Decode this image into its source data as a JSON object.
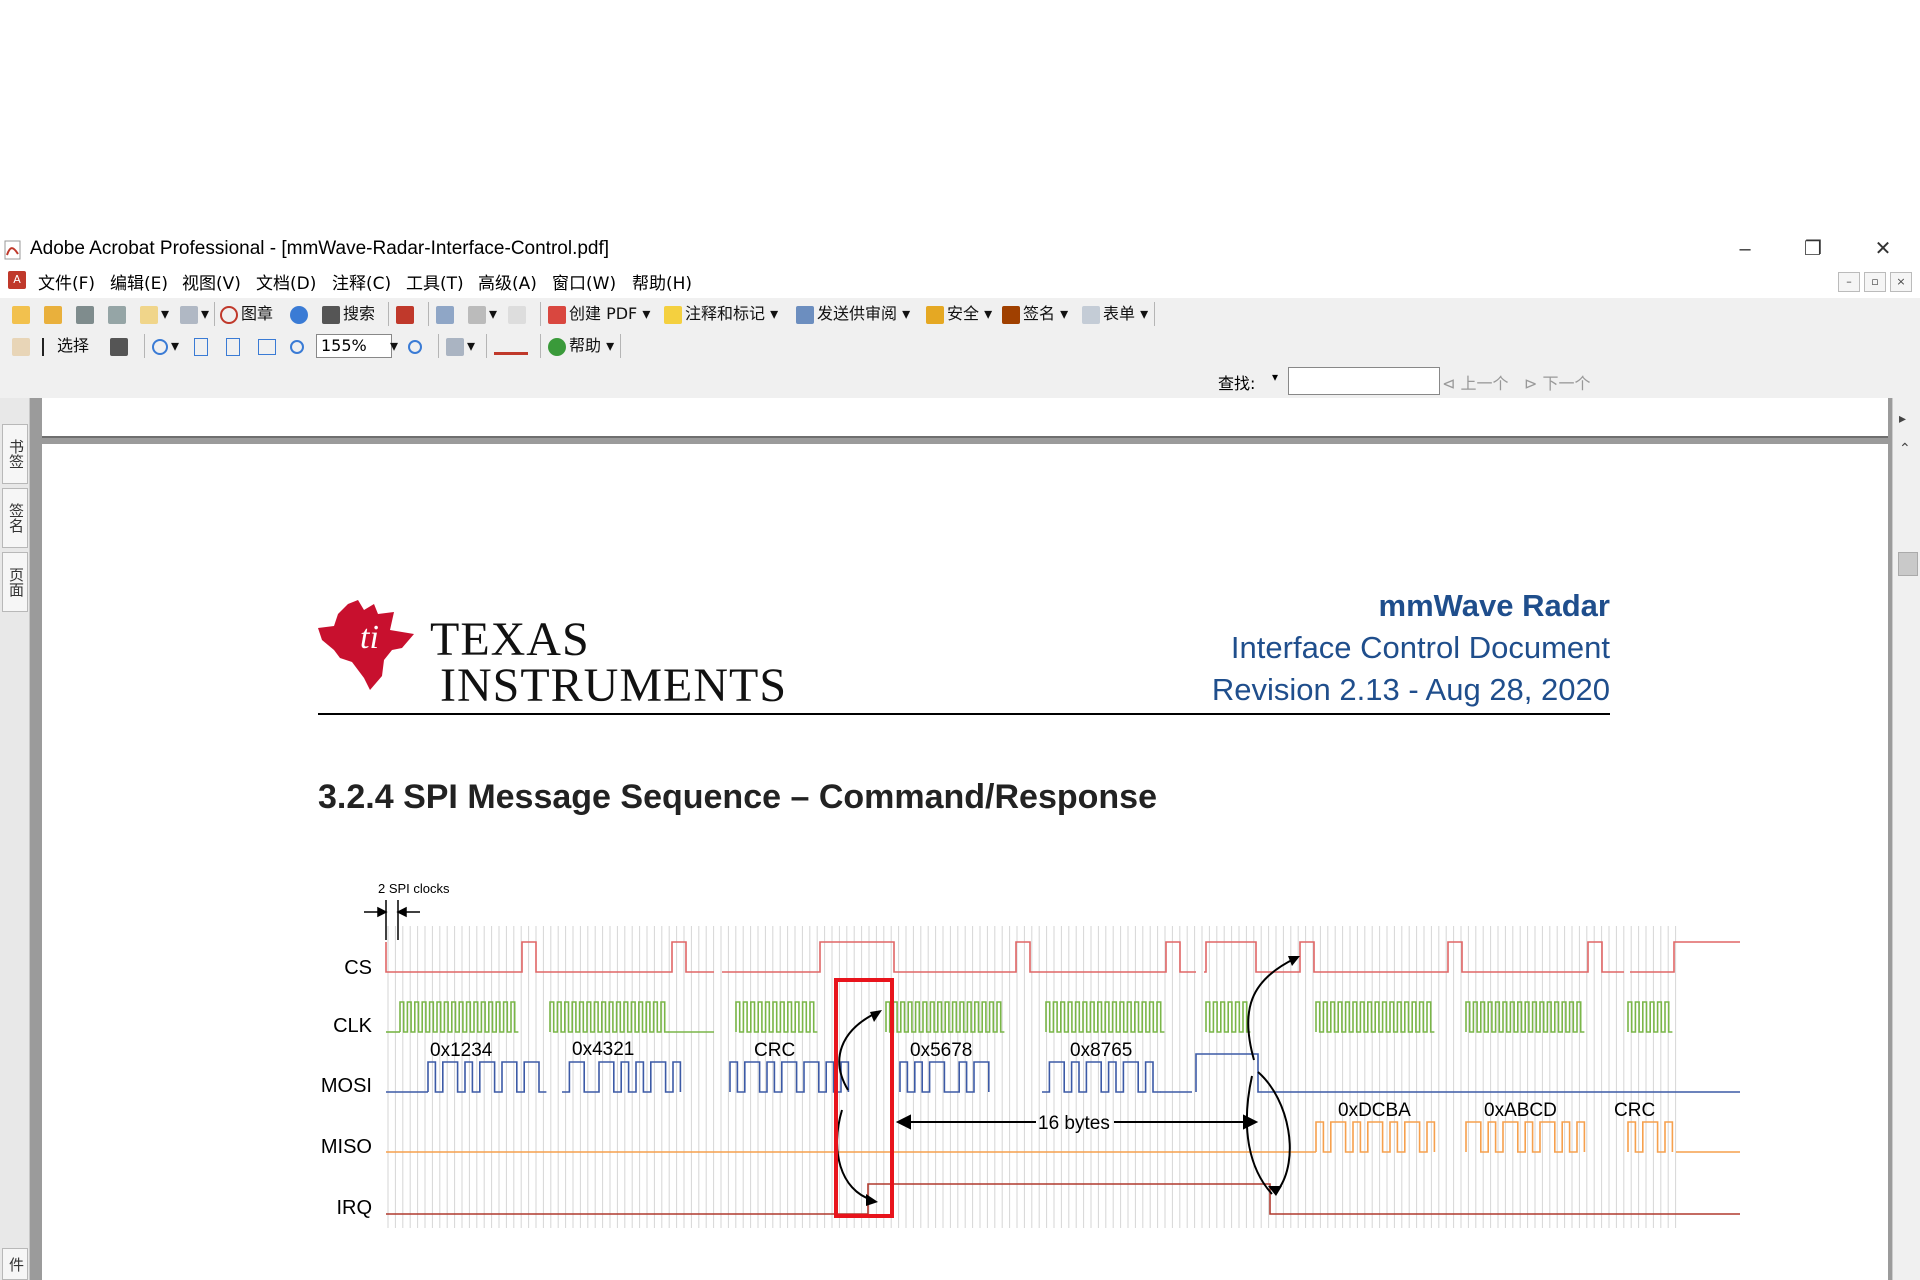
{
  "titlebar": {
    "title": "Adobe Acrobat Professional - [mmWave-Radar-Interface-Control.pdf]",
    "minimize": "–",
    "restore": "❐",
    "close": "✕"
  },
  "menubar": {
    "items": [
      "文件(F)",
      "编辑(E)",
      "视图(V)",
      "文档(D)",
      "注释(C)",
      "工具(T)",
      "高级(A)",
      "窗口(W)",
      "帮助(H)"
    ],
    "mdi_min": "–",
    "mdi_restore": "▫",
    "mdi_close": "×"
  },
  "toolbar1": {
    "stamp": "图章",
    "search": "搜索",
    "create_pdf": "创建 PDF",
    "comment": "注释和标记",
    "send": "发送供审阅",
    "security": "安全",
    "sign": "签名",
    "forms": "表单"
  },
  "toolbar2": {
    "select": "选择",
    "zoom": "155%",
    "help": "帮助"
  },
  "findbar": {
    "label": "查找:",
    "value": "",
    "prev": "上一个",
    "next": "下一个"
  },
  "leftpanel": {
    "tabs": [
      "书签",
      "签名",
      "页面"
    ],
    "bottom_tab": "件"
  },
  "page": {
    "logo_line1": "TEXAS",
    "logo_line2": "INSTRUMENTS",
    "header_title": "mmWave Radar",
    "header_subtitle": "Interface Control Document",
    "header_revision": "Revision 2.13 - Aug 28, 2020",
    "section_heading": "3.2.4  SPI Message Sequence – Command/Response"
  },
  "diagram": {
    "spi_clocks_label": "2 SPI clocks",
    "signals": [
      "CS",
      "CLK",
      "MOSI",
      "MISO",
      "IRQ"
    ],
    "mosi_bytes": [
      "0x1234",
      "0x4321",
      "CRC",
      "0x5678",
      "0x8765"
    ],
    "miso_bytes": [
      "0xDCBA",
      "0xABCD",
      "CRC"
    ],
    "length_label": "16 bytes",
    "colors": {
      "cs": "#e06666",
      "clk": "#7ab648",
      "mosi": "#3c5aa6",
      "miso": "#f6a04d",
      "irq": "#b03a2e",
      "highlight": "#e8141c",
      "header_blue": "#1f4e8c"
    }
  }
}
